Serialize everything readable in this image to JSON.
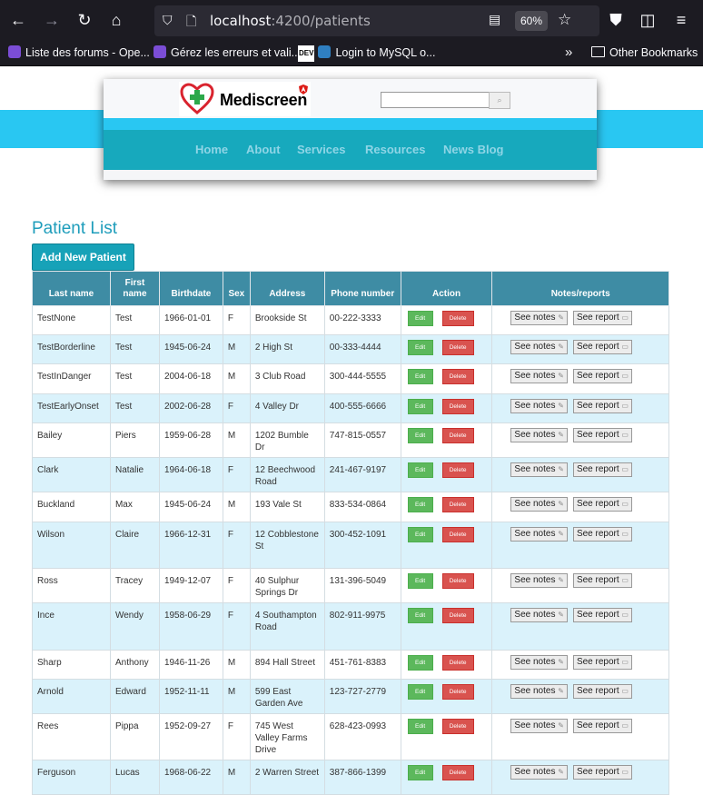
{
  "browser": {
    "url_host": "localhost",
    "url_path": ":4200/patients",
    "zoom": "60%",
    "bookmarks": [
      "Liste des forums - Ope...",
      "Gérez les erreurs et vali...",
      "Login to MySQL o..."
    ],
    "dev_badge": "DEV",
    "other_bookmarks": "Other Bookmarks"
  },
  "header": {
    "logo_text": "Mediscreen",
    "nav": [
      "Home",
      "About",
      "Services",
      "Resources",
      "News Blog"
    ]
  },
  "page": {
    "title": "Patient List",
    "add_button": "Add New Patient"
  },
  "table": {
    "columns": [
      "Last name",
      "First name",
      "Birthdate",
      "Sex",
      "Address",
      "Phone number",
      "Action",
      "Notes/reports"
    ],
    "edit_label": "Edit",
    "delete_label": "Delete",
    "notes_label": "See notes",
    "report_label": "See report",
    "rows": [
      {
        "last": "TestNone",
        "first": "Test",
        "birth": "1966-01-01",
        "sex": "F",
        "address": "Brookside St",
        "phone": "00-222-3333"
      },
      {
        "last": "TestBorderline",
        "first": "Test",
        "birth": "1945-06-24",
        "sex": "M",
        "address": "2 High St",
        "phone": "00-333-4444"
      },
      {
        "last": "TestInDanger",
        "first": "Test",
        "birth": "2004-06-18",
        "sex": "M",
        "address": "3 Club Road",
        "phone": "300-444-5555"
      },
      {
        "last": "TestEarlyOnset",
        "first": "Test",
        "birth": "2002-06-28",
        "sex": "F",
        "address": "4 Valley Dr",
        "phone": "400-555-6666"
      },
      {
        "last": "Bailey",
        "first": "Piers",
        "birth": "1959-06-28",
        "sex": "M",
        "address": "1202 Bumble Dr",
        "phone": "747-815-0557"
      },
      {
        "last": "Clark",
        "first": "Natalie",
        "birth": "1964-06-18",
        "sex": "F",
        "address": "12 Beechwood Road",
        "phone": "241-467-9197"
      },
      {
        "last": "Buckland",
        "first": "Max",
        "birth": "1945-06-24",
        "sex": "M",
        "address": "193 Vale St",
        "phone": "833-534-0864"
      },
      {
        "last": "Wilson",
        "first": "Claire",
        "birth": "1966-12-31",
        "sex": "F",
        "address": "12 Cobblestone St",
        "phone": "300-452-1091"
      },
      {
        "last": "Ross",
        "first": "Tracey",
        "birth": "1949-12-07",
        "sex": "F",
        "address": "40 Sulphur Springs Dr",
        "phone": "131-396-5049"
      },
      {
        "last": "Ince",
        "first": "Wendy",
        "birth": "1958-06-29",
        "sex": "F",
        "address": "4 Southampton Road",
        "phone": "802-911-9975"
      },
      {
        "last": "Sharp",
        "first": "Anthony",
        "birth": "1946-11-26",
        "sex": "M",
        "address": "894 Hall Street",
        "phone": "451-761-8383"
      },
      {
        "last": "Arnold",
        "first": "Edward",
        "birth": "1952-11-11",
        "sex": "M",
        "address": "599 East Garden Ave",
        "phone": "123-727-2779"
      },
      {
        "last": "Rees",
        "first": "Pippa",
        "birth": "1952-09-27",
        "sex": "F",
        "address": "745 West Valley Farms Drive",
        "phone": "628-423-0993"
      },
      {
        "last": "Ferguson",
        "first": "Lucas",
        "birth": "1968-06-22",
        "sex": "M",
        "address": "2 Warren Street",
        "phone": "387-866-1399"
      }
    ]
  }
}
